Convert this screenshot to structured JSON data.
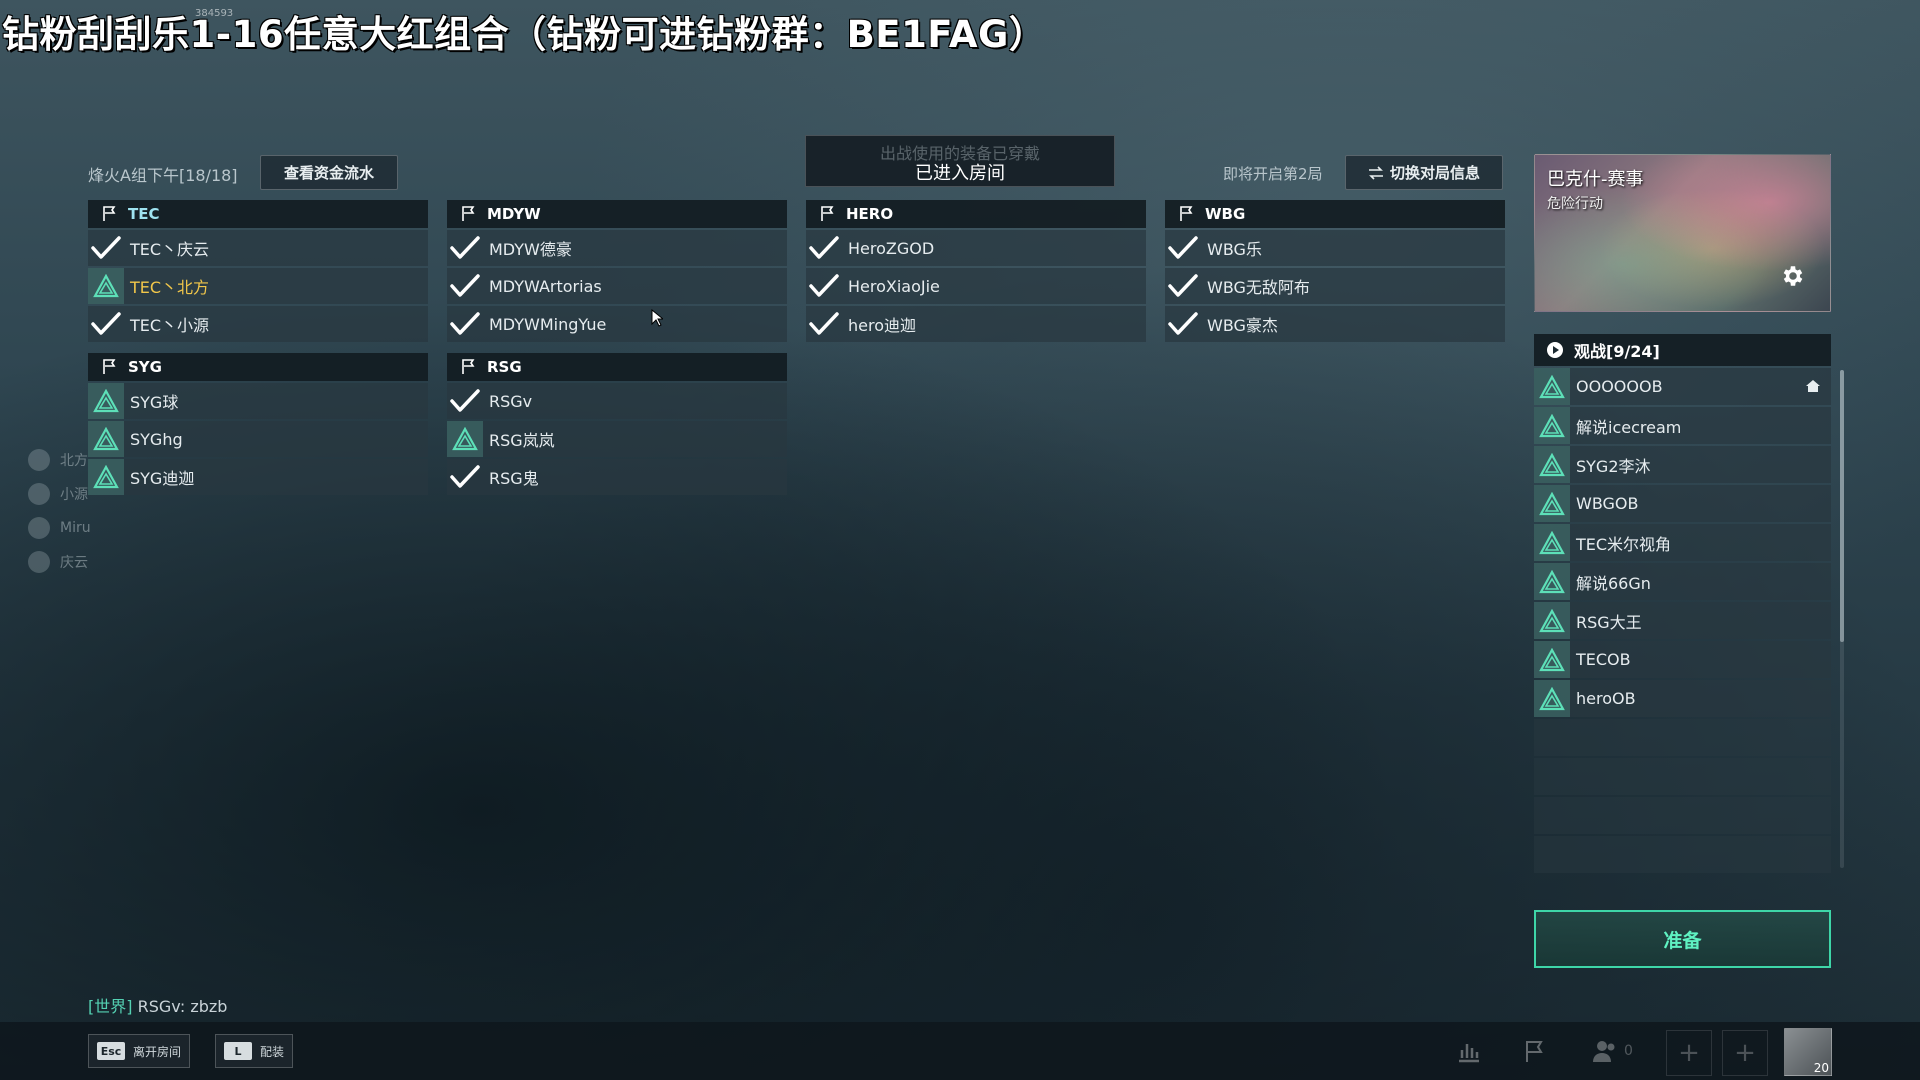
{
  "overlay": {
    "stream_title": "钻粉刮刮乐1-16任意大红组合（钻粉可进钻粉群：BE1FAG）",
    "small_id": "384593"
  },
  "room": {
    "name": "烽火A组下午[18/18]",
    "funds_button": "查看资金流水",
    "notice_faded": "出战使用的装备已穿戴",
    "notice_main": "已进入房间",
    "round_label": "即将开启第2局",
    "switch_button": "切换对局信息"
  },
  "teams": [
    {
      "name": "TEC",
      "players": [
        {
          "name": "TEC丶庆云",
          "status": "ready"
        },
        {
          "name": "TEC丶北方",
          "status": "self"
        },
        {
          "name": "TEC丶小源",
          "status": "ready"
        }
      ]
    },
    {
      "name": "MDYW",
      "players": [
        {
          "name": "MDYW德豪",
          "status": "ready"
        },
        {
          "name": "MDYWArtorias",
          "status": "ready"
        },
        {
          "name": "MDYWMingYue",
          "status": "ready"
        }
      ]
    },
    {
      "name": "HERO",
      "players": [
        {
          "name": "HeroZGOD",
          "status": "ready"
        },
        {
          "name": "HeroXiaoJie",
          "status": "ready"
        },
        {
          "name": "hero迪迦",
          "status": "ready"
        }
      ]
    },
    {
      "name": "WBG",
      "players": [
        {
          "name": "WBG乐",
          "status": "ready"
        },
        {
          "name": "WBG无敌阿布",
          "status": "ready"
        },
        {
          "name": "WBG豪杰",
          "status": "ready"
        }
      ]
    },
    {
      "name": "SYG",
      "players": [
        {
          "name": "SYG球",
          "status": "waiting"
        },
        {
          "name": "SYGhg",
          "status": "waiting"
        },
        {
          "name": "SYG迪迦",
          "status": "waiting"
        }
      ]
    },
    {
      "name": "RSG",
      "players": [
        {
          "name": "RSGv",
          "status": "ready"
        },
        {
          "name": "RSG岚岚",
          "status": "waiting"
        },
        {
          "name": "RSG鬼",
          "status": "ready"
        }
      ]
    }
  ],
  "map": {
    "name": "巴克什-赛事",
    "mode": "危险行动"
  },
  "spectators": {
    "header": "观战[9/24]",
    "list": [
      "OOOOOOB",
      "解说icecream",
      "SYG2李沐",
      "WBGOB",
      "TEC米尔视角",
      "解说66Gn",
      "RSG大王",
      "TECOB",
      "heroOB"
    ]
  },
  "ready_button": "准备",
  "voice": [
    "北方",
    "小源",
    "Miru",
    "庆云"
  ],
  "chat": {
    "channel": "[世界]",
    "message": "RSGv: zbzb"
  },
  "bottom": {
    "leave_key": "Esc",
    "leave_label": "离开房间",
    "loadout_key": "L",
    "loadout_label": "配装",
    "friends_count": "0",
    "level": "20"
  },
  "colors": {
    "accent": "#3ed6a8",
    "self_name": "#f2c74a",
    "team_highlight": "#9fe3f0"
  }
}
